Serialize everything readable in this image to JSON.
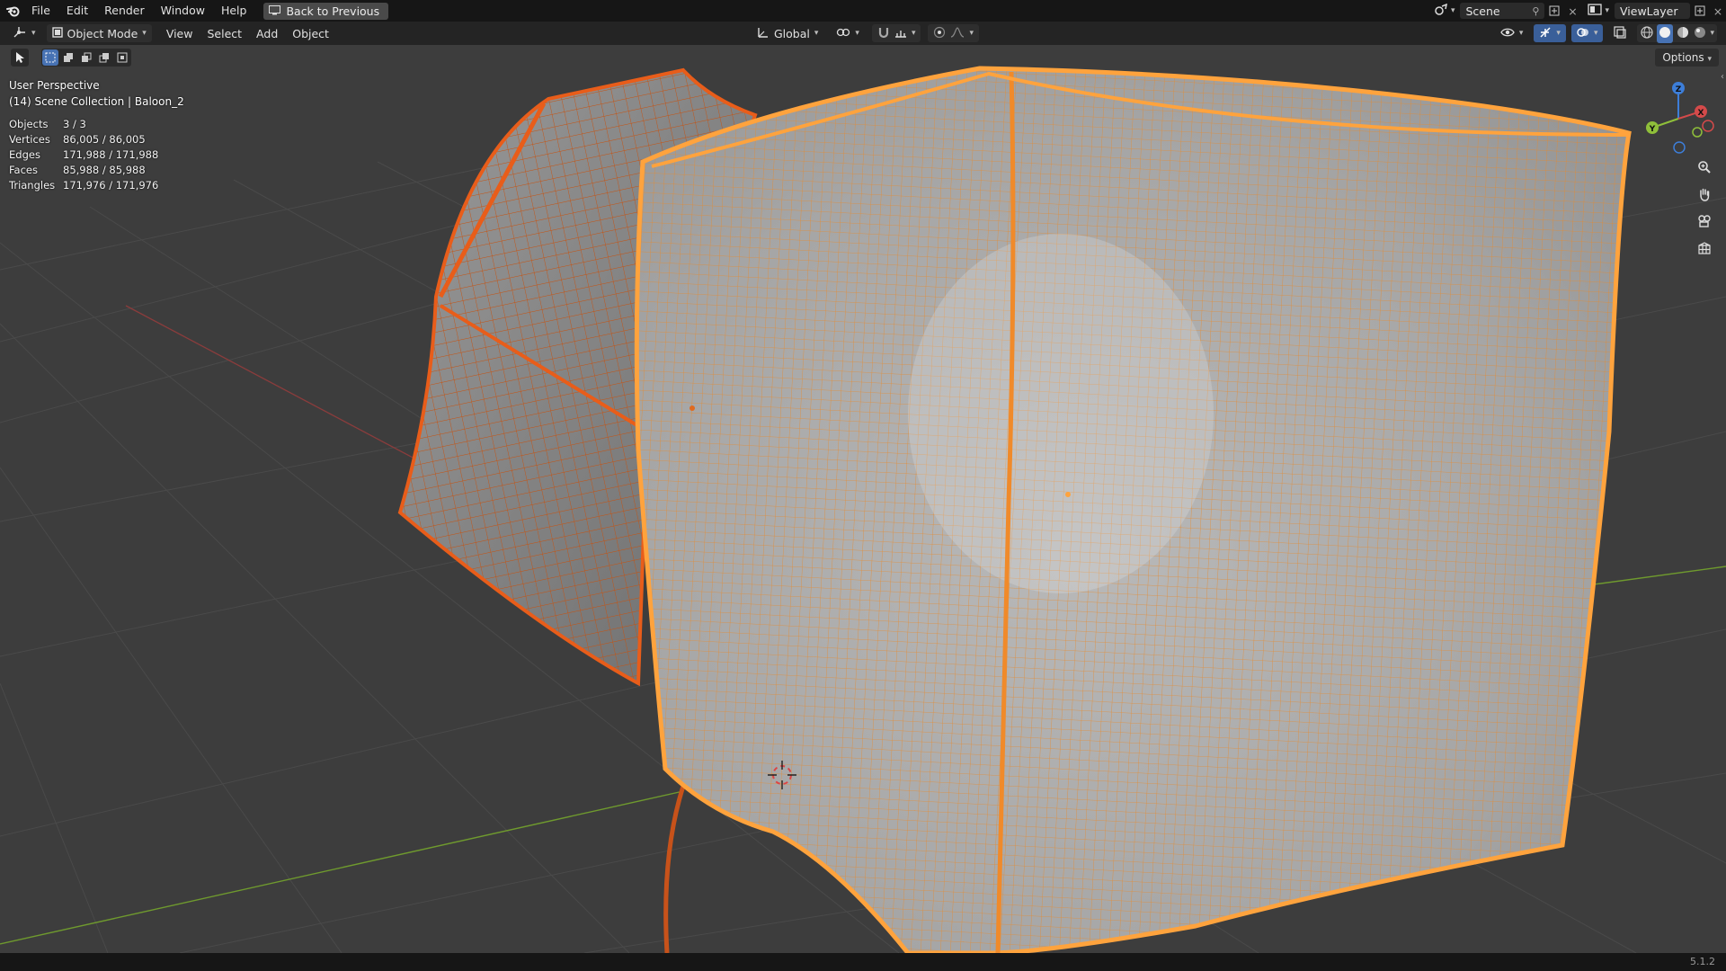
{
  "menu": {
    "items": [
      "File",
      "Edit",
      "Render",
      "Window",
      "Help"
    ],
    "back_button": "Back to Previous"
  },
  "top_right": {
    "scene": "Scene",
    "view_layer": "ViewLayer"
  },
  "header": {
    "mode": "Object Mode",
    "menus": [
      "View",
      "Select",
      "Add",
      "Object"
    ],
    "orientation": "Global"
  },
  "viewport": {
    "perspective": "User Perspective",
    "collection": "(14) Scene Collection | Baloon_2",
    "options_label": "Options",
    "stats": [
      {
        "label": "Objects",
        "value": "3 / 3"
      },
      {
        "label": "Vertices",
        "value": "86,005 / 86,005"
      },
      {
        "label": "Edges",
        "value": "171,988 / 171,988"
      },
      {
        "label": "Faces",
        "value": "85,988 / 85,988"
      },
      {
        "label": "Triangles",
        "value": "171,976 / 171,976"
      }
    ],
    "gizmo": {
      "x": "X",
      "y": "Y",
      "z": "Z"
    }
  },
  "status": {
    "version": "5.1.2"
  },
  "colors": {
    "selected_active": "#ffa33d",
    "selected_other": "#e85d1a",
    "x_axis": "#d44a4a",
    "y_axis": "#8fbf3a",
    "z_axis": "#3d7ed9"
  }
}
